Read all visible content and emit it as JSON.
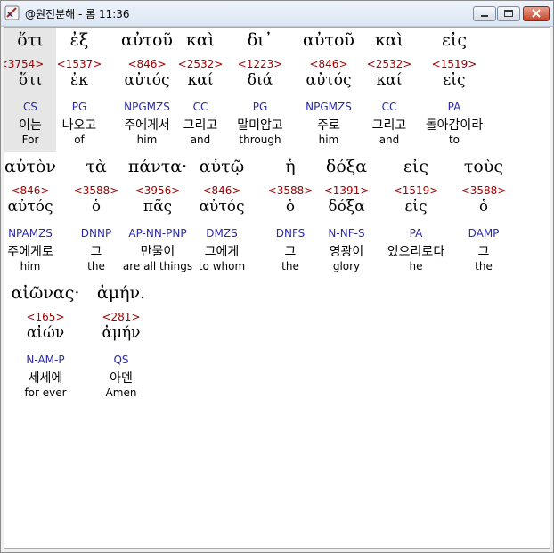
{
  "window": {
    "title": "@원전분해 - 롬 11:36",
    "buttons": {
      "minimize": "minimize-icon",
      "maximize": "maximize-icon",
      "close": "close-icon"
    }
  },
  "rows": [
    [
      {
        "greek": "ὅτι",
        "strong": "<3754>",
        "lemma": "ὅτι",
        "morph": "CS",
        "korean": "이는",
        "english": "For"
      },
      {
        "greek": "ἐξ",
        "strong": "<1537>",
        "lemma": "ἐκ",
        "morph": "PG",
        "korean": "나오고",
        "english": "of"
      },
      {
        "greek": "αὐτοῦ",
        "strong": "<846>",
        "lemma": "αὐτός",
        "morph": "NPGMZS",
        "korean": "주에게서",
        "english": "him"
      },
      {
        "greek": "καὶ",
        "strong": "<2532>",
        "lemma": "καί",
        "morph": "CC",
        "korean": "그리고",
        "english": "and"
      },
      {
        "greek": "δι᾽",
        "strong": "<1223>",
        "lemma": "διά",
        "morph": "PG",
        "korean": "말미암고",
        "english": "through"
      },
      {
        "greek": "αὐτοῦ",
        "strong": "<846>",
        "lemma": "αὐτός",
        "morph": "NPGMZS",
        "korean": "주로",
        "english": "him"
      },
      {
        "greek": "καὶ",
        "strong": "<2532>",
        "lemma": "καί",
        "morph": "CC",
        "korean": "그리고",
        "english": "and"
      },
      {
        "greek": "εἰς",
        "strong": "<1519>",
        "lemma": "εἰς",
        "morph": "PA",
        "korean": "돌아감이라",
        "english": "to"
      }
    ],
    [
      {
        "greek": "αὐτὸν",
        "strong": "<846>",
        "lemma": "αὐτός",
        "morph": "NPAMZS",
        "korean": "주에게로",
        "english": "him"
      },
      {
        "greek": "τὰ",
        "strong": "<3588>",
        "lemma": "ὁ",
        "morph": "DNNP",
        "korean": "그",
        "english": "the"
      },
      {
        "greek": "πάντα·",
        "strong": "<3956>",
        "lemma": "πᾶς",
        "morph": "AP-NN-PNP",
        "korean": "만물이",
        "english": "are all things"
      },
      {
        "greek": "αὐτῷ",
        "strong": "<846>",
        "lemma": "αὐτός",
        "morph": "DMZS",
        "korean": "그에게",
        "english": "to whom"
      },
      {
        "greek": "ἡ",
        "strong": "<3588>",
        "lemma": "ὁ",
        "morph": "DNFS",
        "korean": "그",
        "english": "the"
      },
      {
        "greek": "δόξα",
        "strong": "<1391>",
        "lemma": "δόξα",
        "morph": "N-NF-S",
        "korean": "영광이",
        "english": "glory"
      },
      {
        "greek": "εἰς",
        "strong": "<1519>",
        "lemma": "εἰς",
        "morph": "PA",
        "korean": "있으리로다",
        "english": "he"
      },
      {
        "greek": "τοὺς",
        "strong": "<3588>",
        "lemma": "ὁ",
        "morph": "DAMP",
        "korean": "그",
        "english": "the"
      }
    ],
    [
      {
        "greek": "αἰῶνας·",
        "strong": "<165>",
        "lemma": "αἰών",
        "morph": "N-AM-P",
        "korean": "세세에",
        "english": "for ever"
      },
      {
        "greek": "ἀμήν.",
        "strong": "<281>",
        "lemma": "ἀμήν",
        "morph": "QS",
        "korean": "아멘",
        "english": "Amen"
      }
    ]
  ],
  "colors": {
    "strong": "#a00000",
    "morph": "#2a2aa8",
    "highlight": "#e6e6e6"
  }
}
